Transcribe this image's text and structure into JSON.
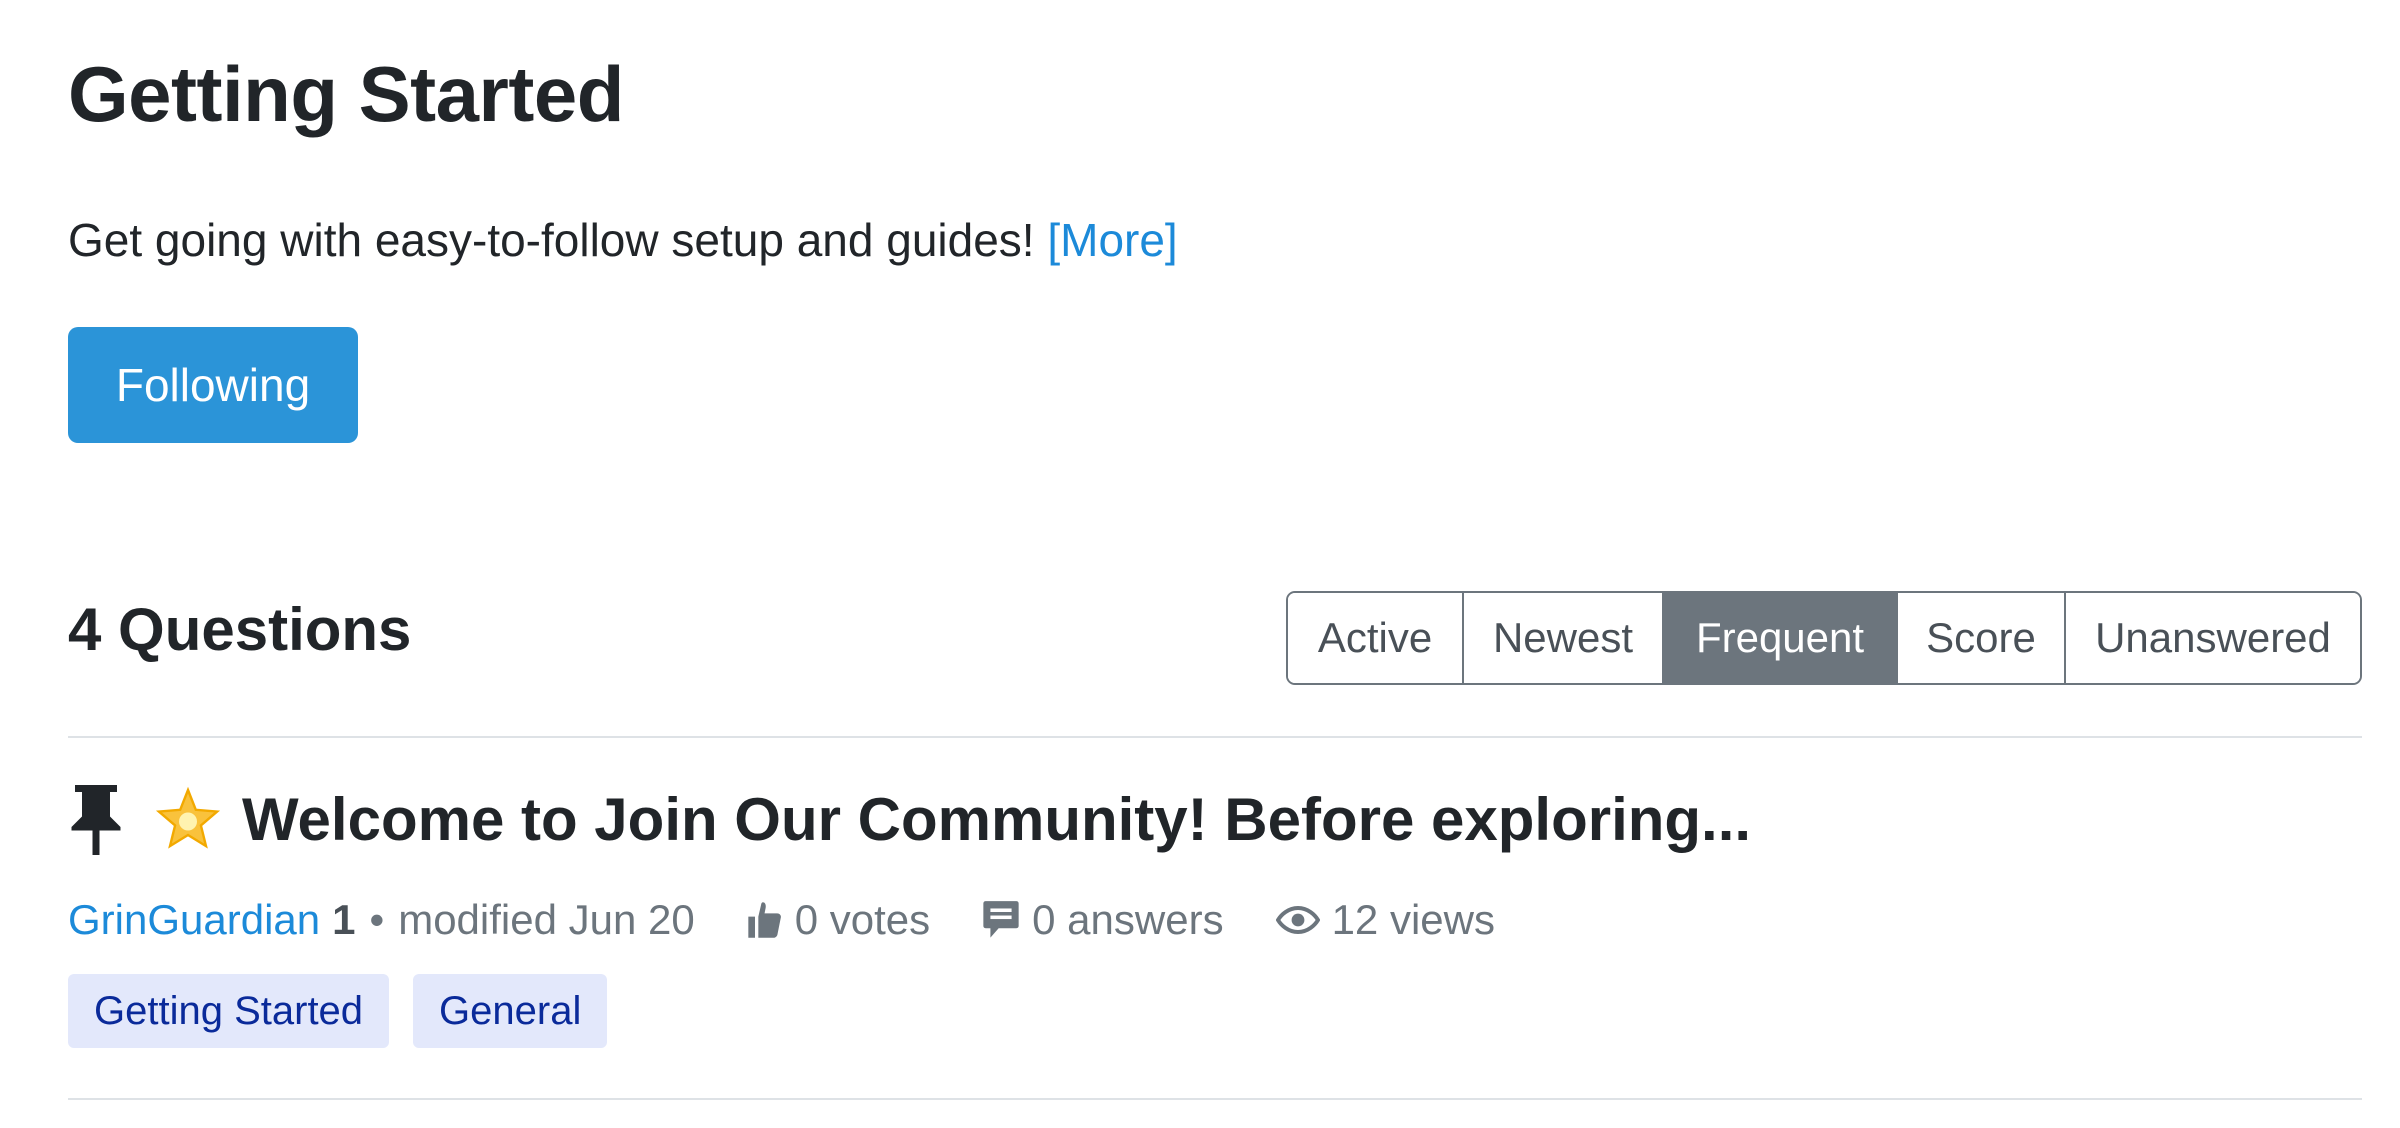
{
  "tag": {
    "title": "Getting Started",
    "description": "Get going with easy-to-follow setup and guides!",
    "more_label": "[More]",
    "follow_label": "Following"
  },
  "questions": {
    "count_label": "4 Questions",
    "sort_options": [
      "Active",
      "Newest",
      "Frequent",
      "Score",
      "Unanswered"
    ],
    "active_sort": "Frequent",
    "items": [
      {
        "pinned": true,
        "title_emoji": "star-icon",
        "title": "Welcome to Join Our Community! Before exploring...",
        "author": "GrinGuardian",
        "author_reputation": "1",
        "separator": "•",
        "modified": "modified Jun 20",
        "votes": "0 votes",
        "answers": "0 answers",
        "views": "12 views",
        "tags": [
          "Getting Started",
          "General"
        ]
      }
    ]
  },
  "colors": {
    "primary": "#2b94d8",
    "link": "#1c8ad9",
    "active_sort_bg": "#6c757d",
    "tag_bg": "#e3e8fb",
    "tag_text": "#0a2a9a"
  },
  "icons": {
    "pin": "pin-icon",
    "votes": "thumbs-up-icon",
    "answers": "comment-icon",
    "views": "eye-icon"
  }
}
